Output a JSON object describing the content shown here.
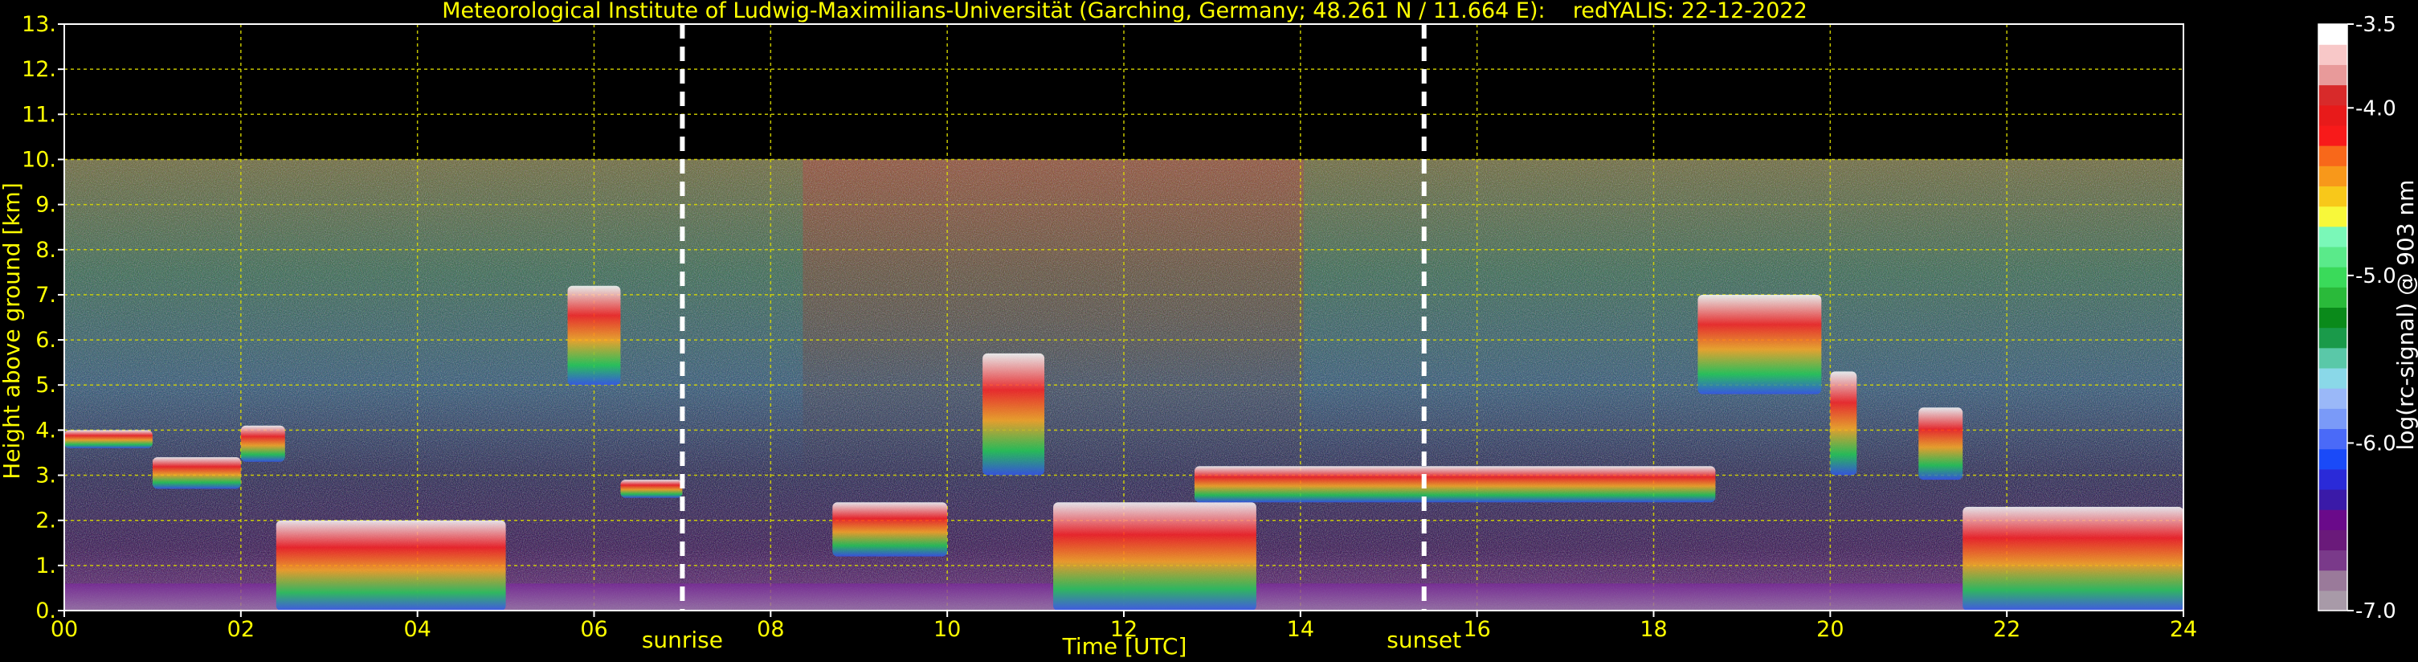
{
  "chart_data": {
    "type": "heatmap",
    "title": "Meteorological Institute of Ludwig-Maximilians-Universität (Garching, Germany; 48.261 N / 11.664 E):    redYALIS: 22-12-2022",
    "xlabel": "Time [UTC]",
    "ylabel": "Height above ground [km]",
    "xlim": [
      0,
      24
    ],
    "ylim": [
      0,
      13
    ],
    "x_ticks": [
      "00",
      "02",
      "04",
      "06",
      "08",
      "10",
      "12",
      "14",
      "16",
      "18",
      "20",
      "22",
      "24"
    ],
    "y_ticks": [
      "0.",
      "1.",
      "2.",
      "3.",
      "4.",
      "5.",
      "6.",
      "7.",
      "8.",
      "9.",
      "10.",
      "11.",
      "12.",
      "13."
    ],
    "grid": true,
    "data_max_height_km": 10,
    "annotations": [
      {
        "label": "sunrise",
        "x": 7.0
      },
      {
        "label": "sunset",
        "x": 15.4
      }
    ],
    "colorbar": {
      "label": "log(rc-signal) @ 903 nm",
      "min": -7.0,
      "max": -3.5,
      "ticks": [
        "-3.5",
        "-4.0",
        "-5.0",
        "-6.0",
        "-7.0"
      ],
      "tick_values": [
        -3.5,
        -4.0,
        -5.0,
        -6.0,
        -7.0
      ],
      "colors": [
        "#a89aa8",
        "#9a7a9a",
        "#7a3a8a",
        "#6a1a7a",
        "#6a0a8a",
        "#3a1aa8",
        "#2a2ad8",
        "#1a4af8",
        "#4a6af8",
        "#7a9af8",
        "#9ab8f8",
        "#8ad8e8",
        "#5ac8a8",
        "#1a9a4a",
        "#0a8a1a",
        "#2aba3a",
        "#3ada5a",
        "#5aea8a",
        "#7af8b8",
        "#f8f83a",
        "#f8c81a",
        "#f8981a",
        "#f8681a",
        "#f81a1a",
        "#e81a1a",
        "#d82a2a",
        "#e89a9a",
        "#f8c8c8",
        "#ffffff"
      ]
    },
    "features": [
      {
        "type": "aerosol_layer",
        "x": [
          0.0,
          24.0
        ],
        "y": [
          0.0,
          0.6
        ]
      },
      {
        "type": "cloud",
        "x": [
          0.0,
          1.0
        ],
        "y": [
          3.6,
          4.0
        ]
      },
      {
        "type": "cloud",
        "x": [
          1.0,
          2.0
        ],
        "y": [
          2.7,
          3.4
        ]
      },
      {
        "type": "cloud",
        "x": [
          2.0,
          2.5
        ],
        "y": [
          3.3,
          4.1
        ]
      },
      {
        "type": "cloud",
        "x": [
          2.4,
          5.0
        ],
        "y": [
          0.0,
          2.0
        ]
      },
      {
        "type": "cloud",
        "x": [
          5.7,
          6.3
        ],
        "y": [
          5.0,
          7.2
        ]
      },
      {
        "type": "cloud",
        "x": [
          6.3,
          7.0
        ],
        "y": [
          2.5,
          2.9
        ]
      },
      {
        "type": "cloud",
        "x": [
          8.7,
          10.0
        ],
        "y": [
          1.2,
          2.4
        ]
      },
      {
        "type": "cloud",
        "x": [
          10.4,
          11.1
        ],
        "y": [
          3.0,
          5.7
        ]
      },
      {
        "type": "cloud",
        "x": [
          11.2,
          13.5
        ],
        "y": [
          0.0,
          2.4
        ]
      },
      {
        "type": "cloud",
        "x": [
          12.8,
          18.7
        ],
        "y": [
          2.4,
          3.2
        ]
      },
      {
        "type": "cloud",
        "x": [
          18.5,
          19.9
        ],
        "y": [
          4.8,
          7.0
        ]
      },
      {
        "type": "cloud",
        "x": [
          20.0,
          20.3
        ],
        "y": [
          3.0,
          5.3
        ]
      },
      {
        "type": "cloud",
        "x": [
          21.0,
          21.5
        ],
        "y": [
          2.9,
          4.5
        ]
      },
      {
        "type": "cloud",
        "x": [
          21.5,
          24.0
        ],
        "y": [
          0.0,
          2.3
        ]
      }
    ]
  }
}
